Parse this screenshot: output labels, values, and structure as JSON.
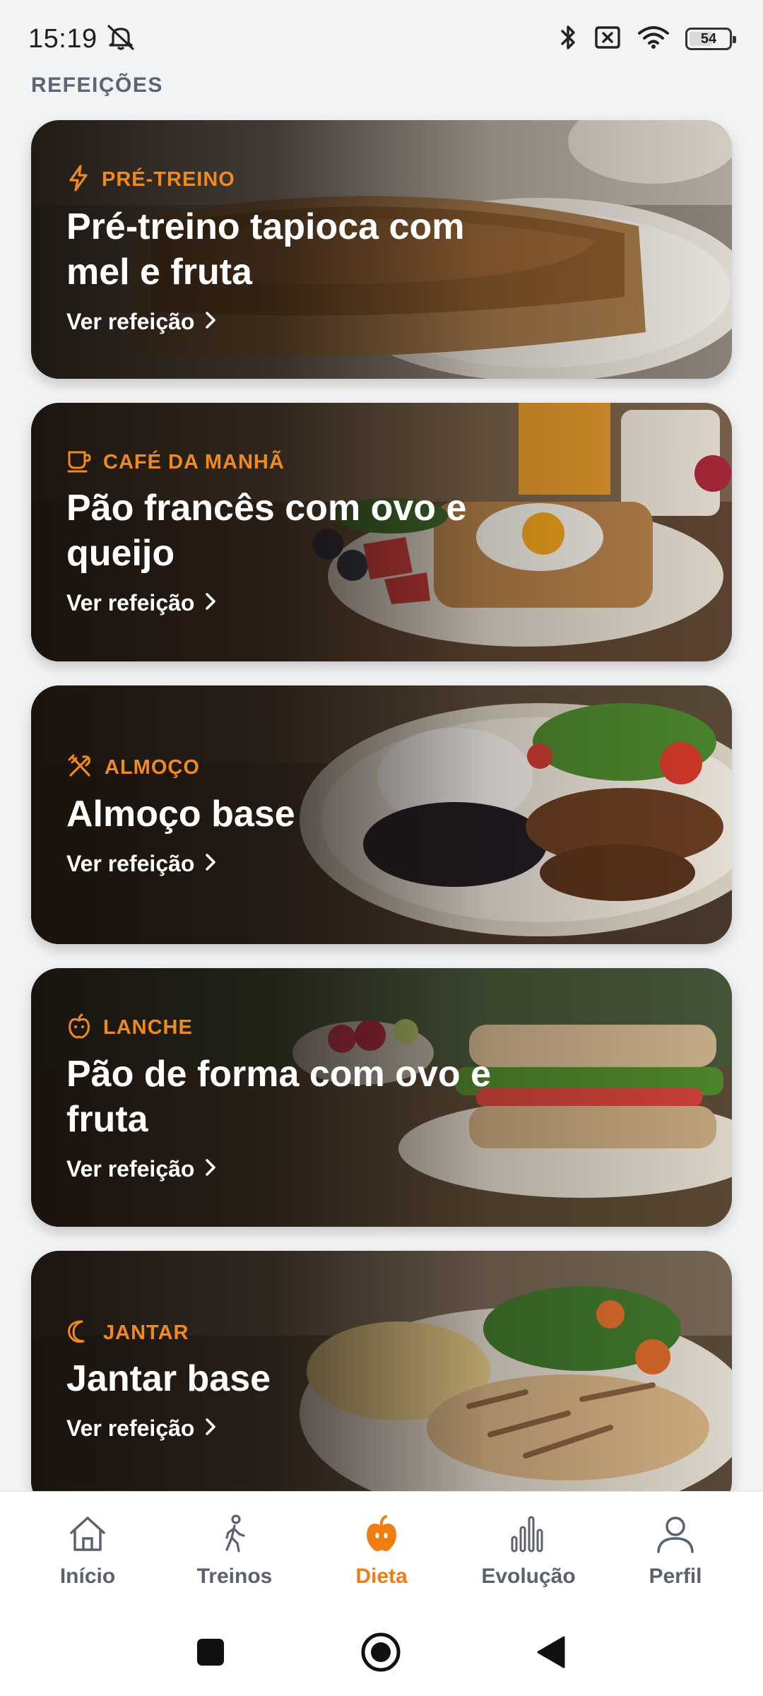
{
  "status_bar": {
    "time": "15:19",
    "battery_percent": "54",
    "icons": [
      "notifications-off-icon",
      "bluetooth-icon",
      "no-sim-icon",
      "wifi-icon",
      "battery-icon"
    ]
  },
  "header": {
    "title": "REFEIÇÕES"
  },
  "colors": {
    "accent": "#f08a1c",
    "background": "#f2f3f5",
    "nav_active": "#f07d12",
    "nav_inactive": "#5a6270"
  },
  "meals": [
    {
      "category": "PRÉ-TREINO",
      "icon": "lightning-icon",
      "title": "Pré-treino tapioca com mel e fruta",
      "link": "Ver refeição"
    },
    {
      "category": "CAFÉ DA MANHÃ",
      "icon": "coffee-cup-icon",
      "title": "Pão francês com ovo e queijo",
      "link": "Ver refeição"
    },
    {
      "category": "ALMOÇO",
      "icon": "utensils-icon",
      "title": "Almoço base",
      "link": "Ver refeição"
    },
    {
      "category": "LANCHE",
      "icon": "apple-icon",
      "title": "Pão de forma com ovo e fruta",
      "link": "Ver refeição"
    },
    {
      "category": "JANTAR",
      "icon": "moon-icon",
      "title": "Jantar base",
      "link": "Ver refeição"
    }
  ],
  "bottom_nav": {
    "items": [
      {
        "label": "Início",
        "icon": "home-icon",
        "active": false
      },
      {
        "label": "Treinos",
        "icon": "walking-person-icon",
        "active": false
      },
      {
        "label": "Dieta",
        "icon": "apple-icon",
        "active": true
      },
      {
        "label": "Evolução",
        "icon": "bar-chart-icon",
        "active": false
      },
      {
        "label": "Perfil",
        "icon": "person-icon",
        "active": false
      }
    ]
  },
  "system_nav": {
    "icons": [
      "recents-square-icon",
      "home-circle-icon",
      "back-triangle-icon"
    ]
  }
}
